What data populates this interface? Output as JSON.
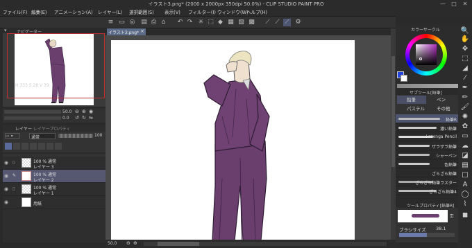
{
  "window": {
    "title": "イラスト3.png* (2000 x 2000px 350dpi 50.0%) - CLIP STUDIO PAINT PRO",
    "controls": [
      "—",
      "□",
      "✕"
    ]
  },
  "menu": [
    "ファイル(F)",
    "編集(E)",
    "アニメーション(A)",
    "レイヤー(L)",
    "選択範囲(S)",
    "表示(V)",
    "フィルター(I)",
    "ウィンドウ(W)",
    "ヘルプ(H)"
  ],
  "navigator": {
    "tab_label": "ナビゲーター",
    "zoom_value": "50.0",
    "rotate_value": "0.0"
  },
  "layer_panel": {
    "tabs": [
      "レイヤー",
      "レイヤープロパティ"
    ],
    "blend_mode": "通常",
    "opacity": "100",
    "layers": [
      {
        "line1": "100 % 通常",
        "line2": "レイヤー 3",
        "selected": false
      },
      {
        "line1": "100 % 通常",
        "line2": "レイヤー 2",
        "selected": true
      },
      {
        "line1": "100 % 通常",
        "line2": "レイヤー 1",
        "selected": false
      },
      {
        "line1": "",
        "line2": "用紙",
        "selected": false
      }
    ]
  },
  "document": {
    "tab_label": "イラスト3.png*"
  },
  "status": {
    "zoom": "50.0"
  },
  "color_panel": {
    "title": "カラーサークル",
    "readout": "H 333  S 28  V 39"
  },
  "subtool": {
    "header": "サブツール[鉛筆]",
    "tabs": [
      "鉛筆",
      "ペン",
      "パステル",
      "その他"
    ],
    "brushes": [
      {
        "name": "鉛筆R",
        "selected": true
      },
      {
        "name": "濃い鉛筆",
        "selected": false
      },
      {
        "name": "Lozenga Pencil",
        "selected": false
      },
      {
        "name": "ザラザラ鉛筆",
        "selected": false
      },
      {
        "name": "シャーペン",
        "selected": false
      },
      {
        "name": "色鉛筆",
        "selected": false
      },
      {
        "name": "ざらざら鉛筆",
        "selected": false
      },
      {
        "name": "ざらざら鉛筆ラスター",
        "selected": false
      },
      {
        "name": "ざらざら鉛筆4",
        "selected": false
      }
    ]
  },
  "tool_property": {
    "header": "ツールプロパティ[鉛筆R]",
    "brush_size_label": "ブラシサイズ",
    "brush_size_value": "38.1"
  },
  "colors": {
    "accent": "#5b6b87",
    "suit": "#6a3f6e",
    "selected_layer": "#565872"
  }
}
